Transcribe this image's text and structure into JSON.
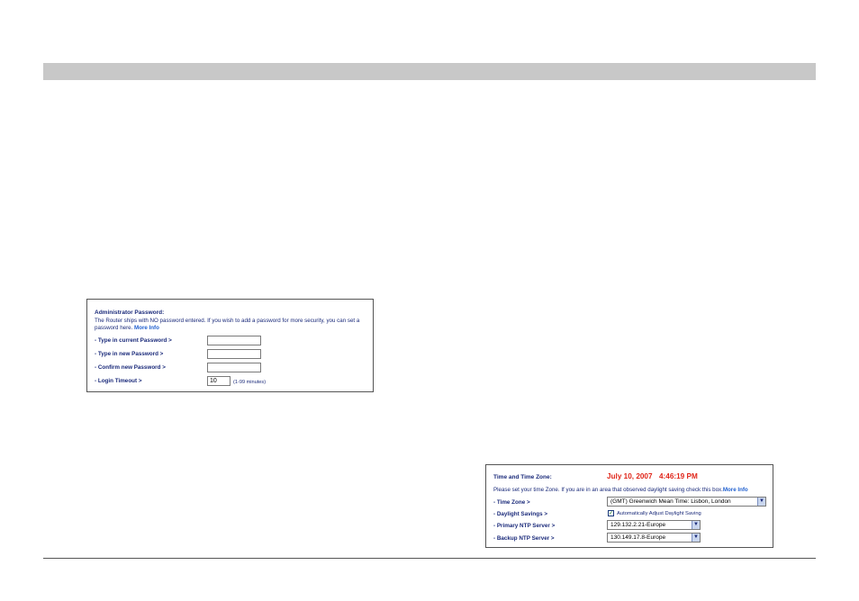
{
  "admin_panel": {
    "title": "Administrator Password:",
    "description": "The Router ships with NO password entered. If you wish to add a password for more security, you can set a password here.",
    "more_info": "More Info",
    "fields": [
      {
        "label": "- Type in current Password >",
        "value": ""
      },
      {
        "label": "- Type in new Password >",
        "value": ""
      },
      {
        "label": "- Confirm new Password >",
        "value": ""
      }
    ],
    "timeout_label": "- Login Timeout >",
    "timeout_value": "10",
    "timeout_hint": "(1-99 minutes)"
  },
  "time_panel": {
    "title": "Time and Time Zone:",
    "date": "July 10, 2007",
    "time": "4:46:19 PM",
    "description": "Please set your time Zone. If you are in an area that observed daylight saving check this box.",
    "more_info": "More Info",
    "time_zone_label": "- Time Zone >",
    "time_zone_value": "(GMT) Greenwich Mean Time: Lisbon, London",
    "daylight_label": "- Daylight Savings >",
    "daylight_checkbox_label": "Automatically Adjust Daylight Saving",
    "daylight_checked": true,
    "primary_ntp_label": "- Primary NTP Server >",
    "primary_ntp_value": "129.132.2.21-Europe",
    "backup_ntp_label": "- Backup NTP Server >",
    "backup_ntp_value": "130.149.17.8-Europe"
  },
  "colors": {
    "header_bar": "#c8c8c8",
    "label_text": "#1a2a7a",
    "link": "#1f5fcf",
    "datetime": "#e0261a"
  },
  "icons": {
    "dropdown_arrow": "chevron-down-icon",
    "checkbox_mark": "check-icon"
  }
}
